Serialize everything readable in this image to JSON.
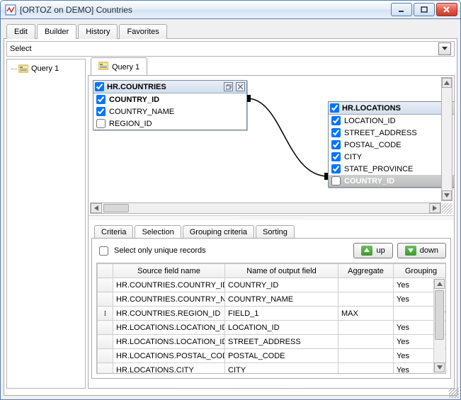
{
  "window": {
    "title": "[ORTOZ on DEMO] Countries"
  },
  "mainTabs": {
    "edit": "Edit",
    "builder": "Builder",
    "history": "History",
    "favorites": "Favorites",
    "active": "Builder"
  },
  "selectCombo": {
    "value": "Select"
  },
  "tree": {
    "query1": "Query 1"
  },
  "queryTabs": {
    "tab1": "Query 1"
  },
  "diagram": {
    "table1": {
      "title": "HR.COUNTRIES",
      "rows": [
        {
          "name": "COUNTRY_ID",
          "checked": true,
          "bold": true
        },
        {
          "name": "COUNTRY_NAME",
          "checked": true,
          "bold": false
        },
        {
          "name": "REGION_ID",
          "checked": false,
          "bold": false
        }
      ]
    },
    "table2": {
      "title": "HR.LOCATIONS",
      "rows": [
        {
          "name": "LOCATION_ID",
          "checked": true
        },
        {
          "name": "STREET_ADDRESS",
          "checked": true
        },
        {
          "name": "POSTAL_CODE",
          "checked": true
        },
        {
          "name": "CITY",
          "checked": true
        },
        {
          "name": "STATE_PROVINCE",
          "checked": true
        },
        {
          "name": "COUNTRY_ID",
          "checked": false,
          "hl": true
        }
      ]
    }
  },
  "subTabs": {
    "criteria": "Criteria",
    "selection": "Selection",
    "grouping": "Grouping criteria",
    "sorting": "Sorting",
    "active": "Selection"
  },
  "selection": {
    "uniqueLabel": "Select only unique records",
    "uniqueChecked": false,
    "upLabel": "up",
    "downLabel": "down",
    "headers": {
      "src": "Source field name",
      "out": "Name of output field",
      "agg": "Aggregate",
      "grp": "Grouping"
    },
    "rows": [
      {
        "src": "HR.COUNTRIES.COUNTRY_ID",
        "out": "COUNTRY_ID",
        "agg": "",
        "grp": "Yes"
      },
      {
        "src": "HR.COUNTRIES.COUNTRY_NA",
        "out": "COUNTRY_NAME",
        "agg": "",
        "grp": "Yes"
      },
      {
        "src": "HR.COUNTRIES.REGION_ID",
        "out": "FIELD_1",
        "agg": "MAX",
        "grp": "",
        "editing": true
      },
      {
        "src": "HR.LOCATIONS.LOCATION_ID",
        "out": "LOCATION_ID",
        "agg": "",
        "grp": "Yes"
      },
      {
        "src": "HR.LOCATIONS.LOCATION_ID",
        "out": "STREET_ADDRESS",
        "agg": "",
        "grp": "Yes"
      },
      {
        "src": "HR.LOCATIONS.POSTAL_CODE",
        "out": "POSTAL_CODE",
        "agg": "",
        "grp": "Yes"
      },
      {
        "src": "HR.LOCATIONS.CITY",
        "out": "CITY",
        "agg": "",
        "grp": "Yes"
      }
    ]
  }
}
